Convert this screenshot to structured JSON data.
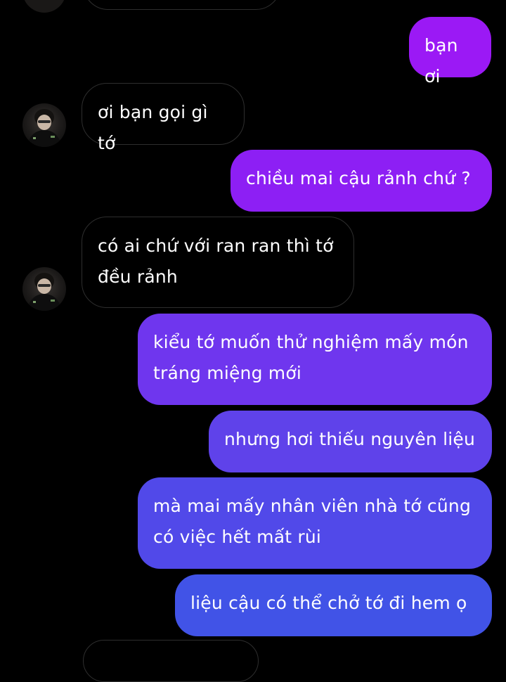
{
  "conversation": {
    "messages": [
      {
        "id": "m1",
        "direction": "outgoing",
        "text": "bạn ơi",
        "color": "#9b19f5"
      },
      {
        "id": "m2",
        "direction": "incoming",
        "text": "ơi bạn gọi gì tớ"
      },
      {
        "id": "m3",
        "direction": "outgoing",
        "text": "chiều mai cậu rảnh chứ ?",
        "color": "#8d1ff4"
      },
      {
        "id": "m4",
        "direction": "incoming",
        "text": "có ai chứ với ran ran thì tớ đều rảnh"
      },
      {
        "id": "m5",
        "direction": "outgoing",
        "text": "kiểu tớ muốn thử nghiệm mấy món tráng miệng mới",
        "color": "#6f36ee"
      },
      {
        "id": "m6",
        "direction": "outgoing",
        "text": "nhưng hơi thiếu nguyên liệu",
        "color": "#5f42ea"
      },
      {
        "id": "m7",
        "direction": "outgoing",
        "text": "mà mai mấy nhân viên nhà tớ cũng có việc hết mất rùi",
        "color": "#5149e9"
      },
      {
        "id": "m8",
        "direction": "outgoing",
        "text": "liệu cậu có thể chở tớ đi hem ọ",
        "color": "#4153e7"
      }
    ]
  }
}
